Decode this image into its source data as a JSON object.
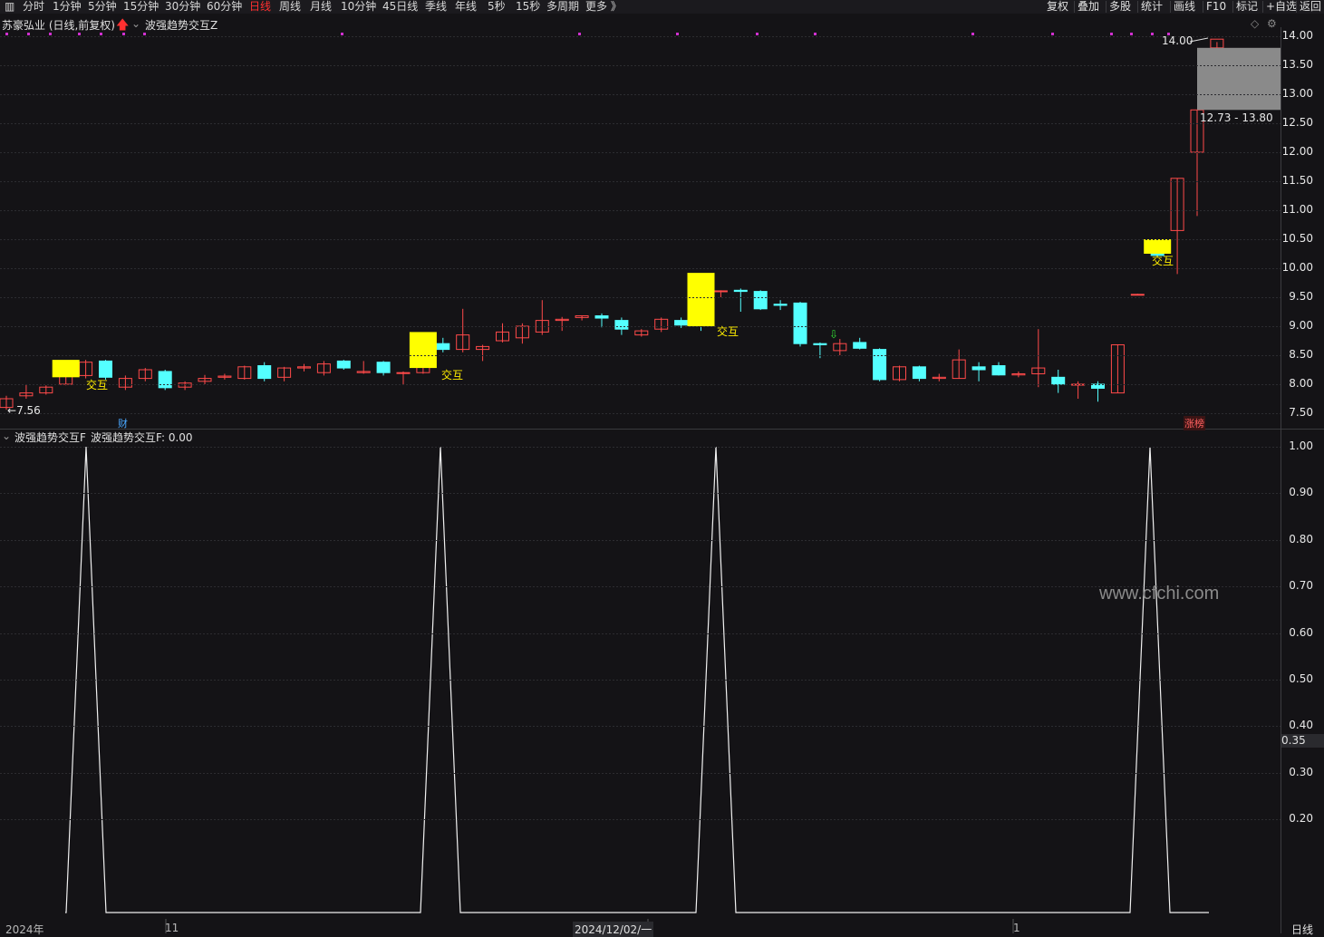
{
  "toolbar": {
    "periods": [
      "分时",
      "1分钟",
      "5分钟",
      "15分钟",
      "30分钟",
      "60分钟",
      "日线",
      "周线",
      "月线",
      "10分钟",
      "45日线",
      "季线",
      "年线",
      "5秒",
      "15秒",
      "多周期",
      "更多 》"
    ],
    "active_period": "日线",
    "right_buttons": [
      "复权",
      "叠加",
      "多股",
      "统计",
      "画线",
      "F10",
      "标记",
      "+自选",
      "返回"
    ]
  },
  "main_chart": {
    "title": "苏豪弘业 (日线,前复权)",
    "indicator_name": "波强趋势交互Z",
    "price_axis": [
      "14.00",
      "13.50",
      "13.00",
      "12.50",
      "12.00",
      "11.50",
      "11.00",
      "10.50",
      "10.00",
      "9.50",
      "9.00",
      "8.50",
      "8.00",
      "7.50"
    ],
    "low_price_marker": "7.56",
    "high_price_marker": "14.00",
    "range_label": "12.73 - 13.80",
    "interaction_label": "交互",
    "finance_badge": "财",
    "limit_badge": "涨榜"
  },
  "sub_chart": {
    "indicator_name": "波强趋势交互F",
    "value_text": "波强趋势交互F: 0.00",
    "axis": [
      "1.00",
      "0.90",
      "0.80",
      "0.70",
      "0.60",
      "0.50",
      "0.40",
      "0.30",
      "0.20"
    ],
    "current_value_tag": "0.35"
  },
  "chart_data": {
    "type": "candlestick",
    "up_color": "#ff4a4a",
    "down_color": "#54ffff",
    "candles": [
      {
        "o": 7.6,
        "h": 7.8,
        "l": 7.56,
        "c": 7.75
      },
      {
        "o": 7.8,
        "h": 8.0,
        "l": 7.75,
        "c": 7.85
      },
      {
        "o": 7.85,
        "h": 7.98,
        "l": 7.82,
        "c": 7.95
      },
      {
        "o": 8.0,
        "h": 8.18,
        "l": 7.98,
        "c": 8.15
      },
      {
        "o": 8.15,
        "h": 8.42,
        "l": 8.1,
        "c": 8.38
      },
      {
        "o": 8.4,
        "h": 8.42,
        "l": 8.08,
        "c": 8.12
      },
      {
        "o": 7.95,
        "h": 8.15,
        "l": 7.9,
        "c": 8.1
      },
      {
        "o": 8.1,
        "h": 8.28,
        "l": 8.05,
        "c": 8.25
      },
      {
        "o": 8.22,
        "h": 8.25,
        "l": 7.9,
        "c": 7.94
      },
      {
        "o": 7.95,
        "h": 8.05,
        "l": 7.9,
        "c": 8.02
      },
      {
        "o": 8.05,
        "h": 8.16,
        "l": 8.0,
        "c": 8.1
      },
      {
        "o": 8.12,
        "h": 8.18,
        "l": 8.08,
        "c": 8.14
      },
      {
        "o": 8.1,
        "h": 8.32,
        "l": 8.08,
        "c": 8.3
      },
      {
        "o": 8.32,
        "h": 8.38,
        "l": 8.05,
        "c": 8.1
      },
      {
        "o": 8.12,
        "h": 8.3,
        "l": 8.05,
        "c": 8.28
      },
      {
        "o": 8.28,
        "h": 8.35,
        "l": 8.22,
        "c": 8.3
      },
      {
        "o": 8.2,
        "h": 8.4,
        "l": 8.15,
        "c": 8.35
      },
      {
        "o": 8.4,
        "h": 8.42,
        "l": 8.25,
        "c": 8.28
      },
      {
        "o": 8.2,
        "h": 8.4,
        "l": 8.18,
        "c": 8.22
      },
      {
        "o": 8.38,
        "h": 8.4,
        "l": 8.15,
        "c": 8.2
      },
      {
        "o": 8.2,
        "h": 8.22,
        "l": 8.0,
        "c": 8.2
      },
      {
        "o": 8.2,
        "h": 8.4,
        "l": 8.18,
        "c": 8.35
      },
      {
        "o": 8.7,
        "h": 8.8,
        "l": 8.55,
        "c": 8.6
      },
      {
        "o": 8.6,
        "h": 9.3,
        "l": 8.55,
        "c": 8.85
      },
      {
        "o": 8.6,
        "h": 8.68,
        "l": 8.4,
        "c": 8.65
      },
      {
        "o": 8.75,
        "h": 9.05,
        "l": 8.72,
        "c": 8.9
      },
      {
        "o": 8.8,
        "h": 9.05,
        "l": 8.7,
        "c": 9.0
      },
      {
        "o": 8.9,
        "h": 9.45,
        "l": 8.85,
        "c": 9.1
      },
      {
        "o": 9.1,
        "h": 9.16,
        "l": 8.92,
        "c": 9.12
      },
      {
        "o": 9.15,
        "h": 9.18,
        "l": 9.1,
        "c": 9.18
      },
      {
        "o": 9.18,
        "h": 9.22,
        "l": 8.98,
        "c": 9.14
      },
      {
        "o": 9.1,
        "h": 9.15,
        "l": 8.85,
        "c": 8.95
      },
      {
        "o": 8.85,
        "h": 8.95,
        "l": 8.82,
        "c": 8.92
      },
      {
        "o": 8.95,
        "h": 9.15,
        "l": 8.9,
        "c": 9.12
      },
      {
        "o": 9.1,
        "h": 9.15,
        "l": 8.97,
        "c": 9.02
      },
      {
        "o": 9.18,
        "h": 9.22,
        "l": 8.92,
        "c": 9.08
      },
      {
        "o": 9.6,
        "h": 9.62,
        "l": 9.5,
        "c": 9.61
      },
      {
        "o": 9.62,
        "h": 9.65,
        "l": 9.25,
        "c": 9.6
      },
      {
        "o": 9.6,
        "h": 9.62,
        "l": 9.28,
        "c": 9.3
      },
      {
        "o": 9.38,
        "h": 9.45,
        "l": 9.28,
        "c": 9.36
      },
      {
        "o": 9.4,
        "h": 9.42,
        "l": 8.65,
        "c": 8.7
      },
      {
        "o": 8.7,
        "h": 8.72,
        "l": 8.45,
        "c": 8.68
      },
      {
        "o": 8.58,
        "h": 8.78,
        "l": 8.5,
        "c": 8.7
      },
      {
        "o": 8.72,
        "h": 8.8,
        "l": 8.6,
        "c": 8.62
      },
      {
        "o": 8.6,
        "h": 8.62,
        "l": 8.05,
        "c": 8.08
      },
      {
        "o": 8.08,
        "h": 8.32,
        "l": 8.05,
        "c": 8.3
      },
      {
        "o": 8.3,
        "h": 8.32,
        "l": 8.05,
        "c": 8.1
      },
      {
        "o": 8.1,
        "h": 8.18,
        "l": 8.05,
        "c": 8.12
      },
      {
        "o": 8.1,
        "h": 8.6,
        "l": 8.1,
        "c": 8.42
      },
      {
        "o": 8.3,
        "h": 8.38,
        "l": 8.05,
        "c": 8.25
      },
      {
        "o": 8.32,
        "h": 8.38,
        "l": 8.15,
        "c": 8.16
      },
      {
        "o": 8.16,
        "h": 8.22,
        "l": 8.12,
        "c": 8.18
      },
      {
        "o": 8.18,
        "h": 8.95,
        "l": 7.95,
        "c": 8.28
      },
      {
        "o": 8.12,
        "h": 8.25,
        "l": 7.85,
        "c": 8.0
      },
      {
        "o": 8.0,
        "h": 8.05,
        "l": 7.75,
        "c": 8.0
      },
      {
        "o": 8.0,
        "h": 8.05,
        "l": 7.7,
        "c": 7.93
      },
      {
        "o": 7.85,
        "h": 8.68,
        "l": 7.85,
        "c": 8.68
      },
      {
        "o": 9.55,
        "h": 9.56,
        "l": 9.54,
        "c": 9.55
      },
      {
        "o": 10.45,
        "h": 10.5,
        "l": 10.2,
        "c": 10.22
      },
      {
        "o": 10.65,
        "h": 11.55,
        "l": 9.9,
        "c": 11.55
      },
      {
        "o": 12.0,
        "h": 12.73,
        "l": 10.9,
        "c": 12.73
      },
      {
        "o": 13.8,
        "h": 13.9,
        "l": 13.7,
        "c": 13.95
      }
    ],
    "indicator_values": [
      0,
      0,
      0,
      1,
      0,
      0,
      0,
      0,
      0,
      0,
      0,
      0,
      0,
      0,
      0,
      0,
      0,
      0,
      0,
      0,
      1,
      0,
      0,
      0,
      0,
      0,
      0,
      0,
      0,
      0,
      0,
      0,
      0,
      0,
      1,
      0,
      0,
      0,
      0,
      0,
      0,
      0,
      0,
      0,
      0,
      0,
      0,
      0,
      0,
      0,
      0,
      0,
      0,
      0,
      0,
      0,
      0,
      1,
      0,
      0,
      0,
      0
    ],
    "x_labels": [
      "2024年",
      "11",
      "2024/12/02/一",
      "1",
      "日线"
    ],
    "y_range_price": [
      7.4,
      14.1
    ],
    "y_range_indicator": [
      0,
      1.04
    ]
  }
}
